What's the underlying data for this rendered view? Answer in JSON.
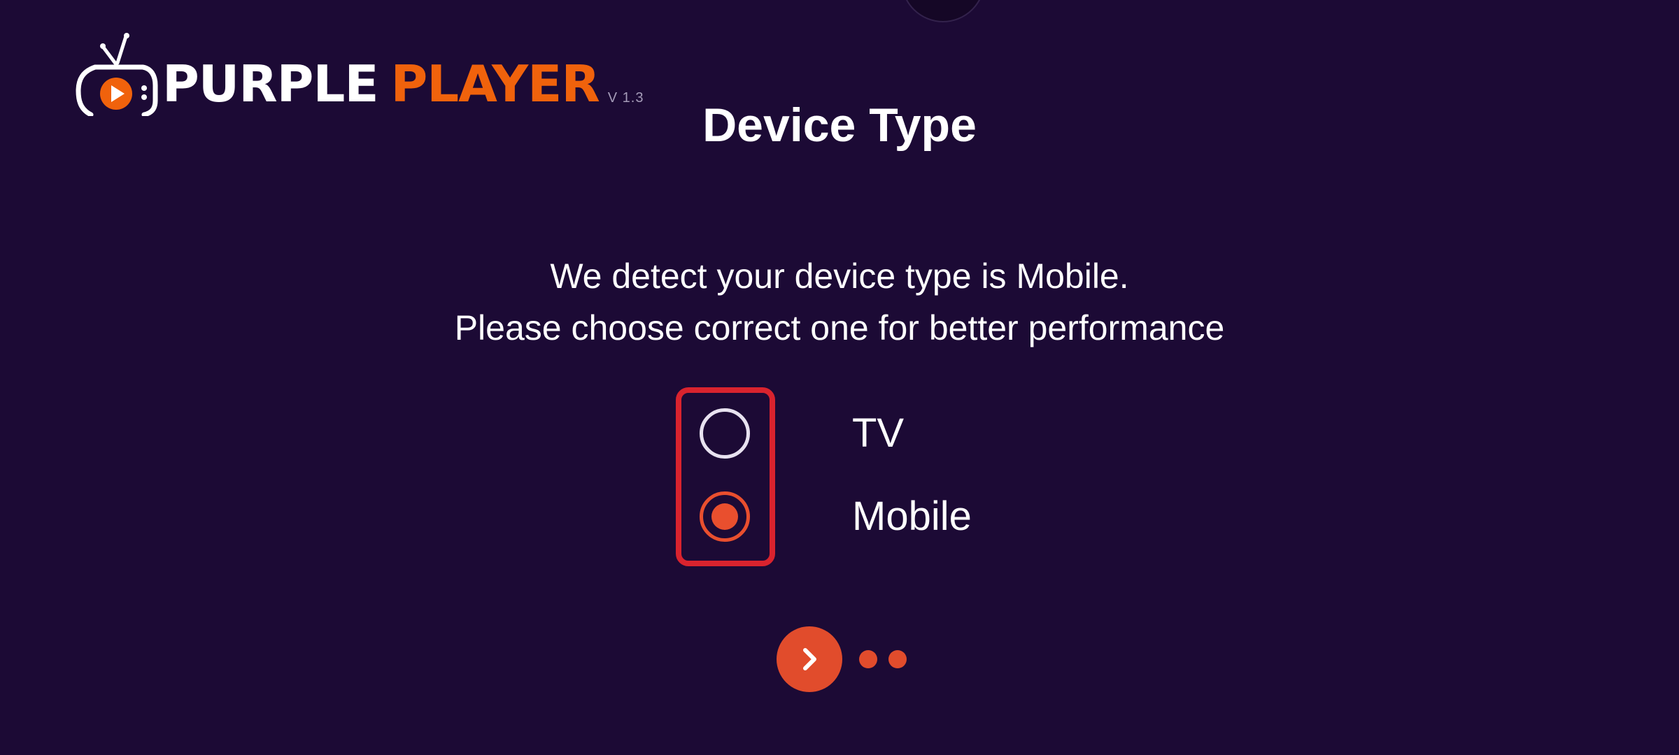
{
  "app": {
    "logo_word_1": "PURPLE",
    "logo_word_2": "PLAYER",
    "version": "V 1.3"
  },
  "page": {
    "title": "Device Type",
    "message_line_1": "We detect your device type is Mobile.",
    "message_line_2": "Please choose correct one for better performance"
  },
  "device_options": {
    "selected": "Mobile",
    "items": [
      {
        "label": "TV",
        "checked": false
      },
      {
        "label": "Mobile",
        "checked": true
      }
    ]
  },
  "pager": {
    "total_dots": 2
  },
  "icons": {
    "logo": "tv-play-icon",
    "next": "chevron-right-icon"
  },
  "colors": {
    "background": "#1c0a35",
    "accent": "#e14c2c",
    "logo_orange": "#f0620c",
    "focus_border": "#d9232e",
    "text": "#ffffff"
  }
}
